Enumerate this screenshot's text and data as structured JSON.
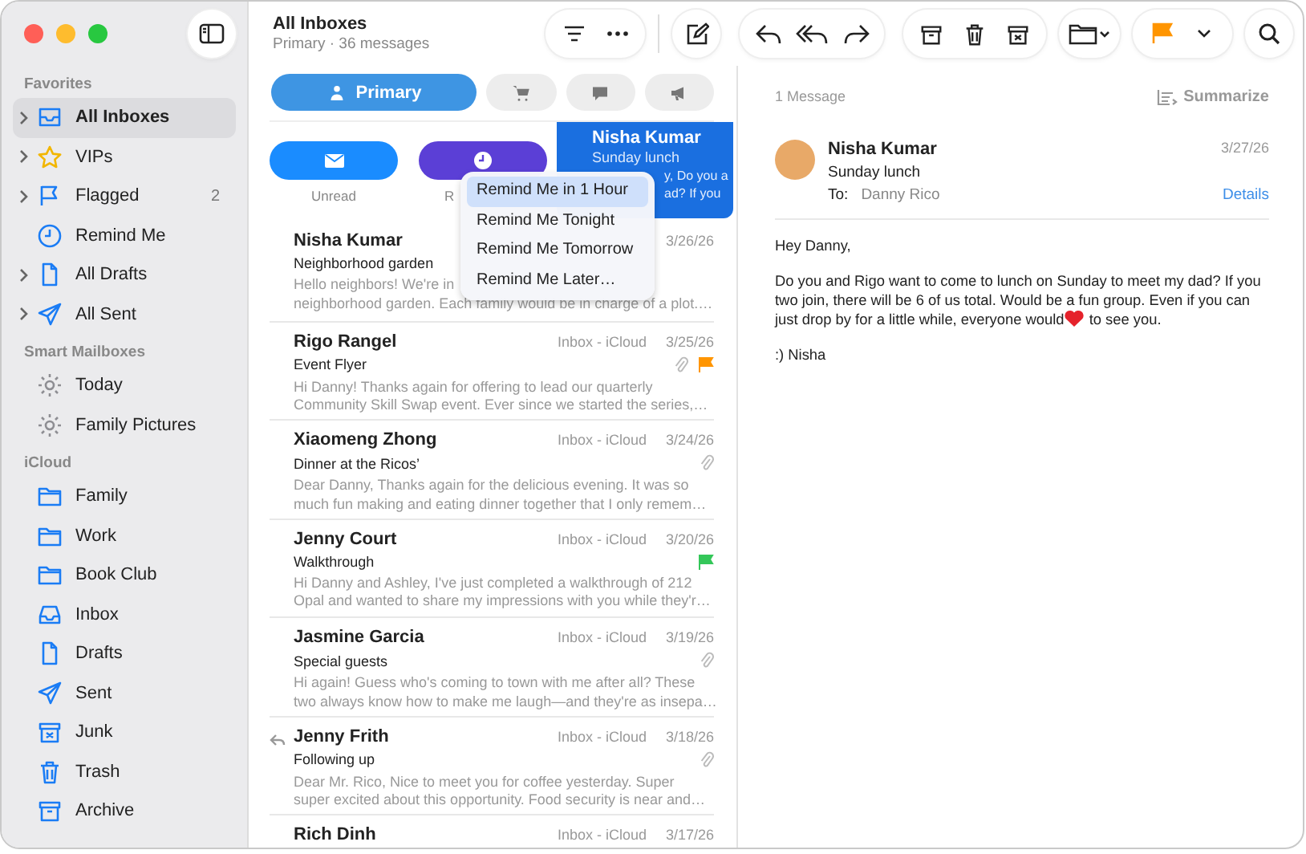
{
  "sidebar": {
    "sections": [
      {
        "title": "Favorites",
        "items": [
          {
            "label": "All Inboxes",
            "expandable": true,
            "selected": true
          },
          {
            "label": "VIPs",
            "expandable": true,
            "selected": false
          },
          {
            "label": "Flagged",
            "expandable": true,
            "selected": false,
            "count": "2"
          },
          {
            "label": "Remind Me",
            "expandable": false,
            "selected": false
          },
          {
            "label": "All Drafts",
            "expandable": true,
            "selected": false
          },
          {
            "label": "All Sent",
            "expandable": true,
            "selected": false
          }
        ]
      },
      {
        "title": "Smart Mailboxes",
        "items": [
          {
            "label": "Today",
            "expandable": false,
            "selected": false
          },
          {
            "label": "Family Pictures",
            "expandable": false,
            "selected": false
          }
        ]
      },
      {
        "title": "iCloud",
        "items": [
          {
            "label": "Family",
            "expandable": false,
            "selected": false
          },
          {
            "label": "Work",
            "expandable": false,
            "selected": false
          },
          {
            "label": "Book Club",
            "expandable": false,
            "selected": false
          },
          {
            "label": "Inbox",
            "expandable": false,
            "selected": false
          },
          {
            "label": "Drafts",
            "expandable": false,
            "selected": false
          },
          {
            "label": "Sent",
            "expandable": false,
            "selected": false
          },
          {
            "label": "Junk",
            "expandable": false,
            "selected": false
          },
          {
            "label": "Trash",
            "expandable": false,
            "selected": false
          },
          {
            "label": "Archive",
            "expandable": false,
            "selected": false
          }
        ]
      }
    ]
  },
  "mailbox": {
    "title": "All Inboxes",
    "subtitle": "Primary · 36 messages"
  },
  "category_tabs": [
    {
      "label": "Primary",
      "selected": true
    },
    {
      "selected": false
    },
    {
      "selected": false
    },
    {
      "selected": false
    }
  ],
  "swipe_actions": [
    {
      "kind": "unread",
      "label": "Unread"
    },
    {
      "kind": "remind",
      "label": "R"
    }
  ],
  "swiped_message": {
    "sender": "Nisha Kumar",
    "subject": "Sunday lunch",
    "preview_lines": [
      "y, Do you a",
      "ad? If you"
    ]
  },
  "remind_menu": [
    {
      "label": "Remind Me in 1 Hour",
      "selected": true
    },
    {
      "label": "Remind Me Tonight",
      "selected": false
    },
    {
      "label": "Remind Me Tomorrow",
      "selected": false
    },
    {
      "label": "Remind Me Later…",
      "selected": false
    }
  ],
  "messages": [
    {
      "sender": "Nisha Kumar",
      "date": "3/26/26",
      "subject": "Neighborhood garden",
      "preview": "Hello neighbors! We're in",
      "preview_2": "neighborhood garden. Each family would be in charge of a plot.…",
      "attachment": false,
      "replied": false
    },
    {
      "sender": "Rigo Rangel",
      "mailbox": "Inbox - iCloud",
      "date": "3/25/26",
      "subject": "Event Flyer",
      "preview": "Hi Danny! Thanks again for offering to lead our quarterly",
      "preview_2": "Community Skill Swap event. Ever since we started the series,…",
      "attachment": true,
      "replied": false,
      "color": "#ff9500"
    },
    {
      "sender": "Xiaomeng Zhong",
      "mailbox": "Inbox - iCloud",
      "date": "3/24/26",
      "subject": "Dinner at the Ricos’",
      "preview": "Dear Danny, Thanks again for the delicious evening. It was so",
      "preview_2": "much fun making and eating dinner together that I only remem…",
      "attachment": true,
      "replied": false
    },
    {
      "sender": "Jenny Court",
      "mailbox": "Inbox - iCloud",
      "date": "3/20/26",
      "subject": "Walkthrough",
      "preview": "Hi Danny and Ashley, I've just completed a walkthrough of 212",
      "preview_2": "Opal and wanted to share my impressions with you while they'r…",
      "attachment": false,
      "replied": false,
      "color": "#34c759"
    },
    {
      "sender": "Jasmine Garcia",
      "mailbox": "Inbox - iCloud",
      "date": "3/19/26",
      "subject": "Special guests",
      "preview": "Hi again! Guess who's coming to town with me after all? These",
      "preview_2": "two always know how to make me laugh—and they're as insepa…",
      "attachment": true,
      "replied": false
    },
    {
      "sender": "Jenny Frith",
      "mailbox": "Inbox - iCloud",
      "date": "3/18/26",
      "subject": "Following up",
      "preview": "Dear Mr. Rico, Nice to meet you for coffee yesterday. Super",
      "preview_2": "super excited about this opportunity. Food security is near and…",
      "attachment": true,
      "replied": true
    },
    {
      "sender": "Rich Dinh",
      "mailbox": "Inbox - iCloud",
      "date": "3/17/26",
      "attachment": false,
      "replied": false
    }
  ],
  "reader": {
    "count": "1 Message",
    "summarize": "Summarize",
    "sender": "Nisha Kumar",
    "subject": "Sunday lunch",
    "to_label": "To:",
    "to": "Danny Rico",
    "date": "3/27/26",
    "details": "Details",
    "body": [
      {
        "text": "Hey Danny,"
      },
      {
        "text": "Do you and Rigo want to come to lunch on Sunday to meet my dad? If you two join, there will be 6 of us total. Would be a fun group. Even if you can just drop by for a little while, everyone would",
        "heart": true,
        "after": "to see you."
      },
      {
        "text": ":) Nisha"
      }
    ]
  }
}
